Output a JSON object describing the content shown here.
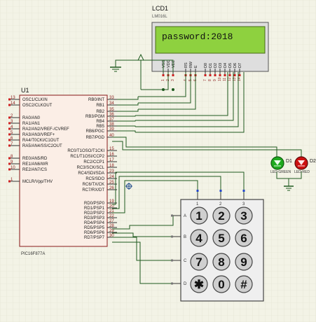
{
  "lcd": {
    "ref": "LCD1",
    "model": "LM016L",
    "display_text": "password:2018",
    "pins": [
      "VSS",
      "VDD",
      "VEE",
      "RS",
      "RW",
      "E",
      "D0",
      "D1",
      "D2",
      "D3",
      "D4",
      "D5",
      "D6",
      "D7"
    ],
    "pin_numbers": [
      "1",
      "2",
      "3",
      "4",
      "5",
      "6",
      "7",
      "8",
      "9",
      "10",
      "11",
      "12",
      "13",
      "14"
    ]
  },
  "mcu": {
    "ref": "U1",
    "model": "PIC16F877A",
    "left_pins": [
      {
        "num": "13",
        "name": "OSC1/CLKIN"
      },
      {
        "num": "14",
        "name": "OSC2/CLKOUT"
      },
      {
        "num": "2",
        "name": "RA0/AN0"
      },
      {
        "num": "3",
        "name": "RA1/AN1"
      },
      {
        "num": "4",
        "name": "RA2/AN2/VREF-/CVREF"
      },
      {
        "num": "5",
        "name": "RA3/AN3/VREF+"
      },
      {
        "num": "6",
        "name": "RA4/T0CKI/C1OUT"
      },
      {
        "num": "7",
        "name": "RA5/AN4/SS/C2OUT"
      },
      {
        "num": "8",
        "name": "RE0/AN5/RD"
      },
      {
        "num": "9",
        "name": "RE1/AN6/WR"
      },
      {
        "num": "10",
        "name": "RE2/AN7/CS"
      },
      {
        "num": "1",
        "name": "MCLR/Vpp/THV"
      }
    ],
    "right_pins": [
      {
        "num": "33",
        "name": "RB0/INT"
      },
      {
        "num": "34",
        "name": "RB1"
      },
      {
        "num": "35",
        "name": "RB2"
      },
      {
        "num": "36",
        "name": "RB3/PGM"
      },
      {
        "num": "37",
        "name": "RB4"
      },
      {
        "num": "38",
        "name": "RB5"
      },
      {
        "num": "39",
        "name": "RB6/PGC"
      },
      {
        "num": "40",
        "name": "RB7/PGD"
      },
      {
        "num": "15",
        "name": "RC0/T1OSO/T1CKI"
      },
      {
        "num": "16",
        "name": "RC1/T1OSI/CCP2"
      },
      {
        "num": "17",
        "name": "RC2/CCP1"
      },
      {
        "num": "18",
        "name": "RC3/SCK/SCL"
      },
      {
        "num": "23",
        "name": "RC4/SDI/SDA"
      },
      {
        "num": "24",
        "name": "RC5/SDO"
      },
      {
        "num": "25",
        "name": "RC6/TX/CK"
      },
      {
        "num": "26",
        "name": "RC7/RX/DT"
      },
      {
        "num": "19",
        "name": "RD0/PSP0"
      },
      {
        "num": "20",
        "name": "RD1/PSP1"
      },
      {
        "num": "21",
        "name": "RD2/PSP2"
      },
      {
        "num": "22",
        "name": "RD3/PSP3"
      },
      {
        "num": "27",
        "name": "RD4/PSP4"
      },
      {
        "num": "28",
        "name": "RD5/PSP5"
      },
      {
        "num": "29",
        "name": "RD6/PSP6"
      },
      {
        "num": "30",
        "name": "RD7/PSP7"
      }
    ]
  },
  "keypad": {
    "rows": [
      "A",
      "B",
      "C",
      "D"
    ],
    "cols": [
      "1",
      "2",
      "3"
    ],
    "keys": [
      "1",
      "2",
      "3",
      "4",
      "5",
      "6",
      "7",
      "8",
      "9",
      "✱",
      "0",
      "#"
    ]
  },
  "leds": [
    {
      "ref": "D1",
      "color_name": "LED-GREEN",
      "fill": "#1faa1f"
    },
    {
      "ref": "D2",
      "color_name": "LED-RED",
      "fill": "#cc1111"
    }
  ],
  "colors": {
    "wire": "#1f5a1f",
    "chip": "#8a1a1a",
    "lcd_bg": "#8ed13f",
    "bg": "#f3f3e6"
  }
}
